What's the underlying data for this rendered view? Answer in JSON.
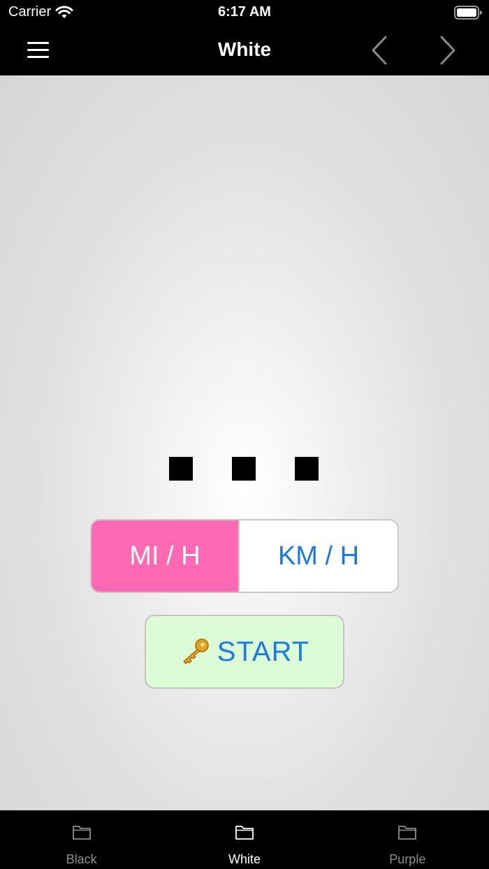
{
  "status_bar": {
    "carrier": "Carrier",
    "time": "6:17 AM"
  },
  "nav": {
    "title": "White",
    "menu_icon": "hamburger-menu-icon",
    "prev_icon": "chevron-left-icon",
    "next_icon": "chevron-right-icon"
  },
  "units": {
    "options": [
      {
        "label": "MI / H",
        "selected": true
      },
      {
        "label": "KM / H",
        "selected": false
      }
    ],
    "selected_color": "#ff69b4",
    "unselected_text_color": "#1a7ae2"
  },
  "start": {
    "icon": "🔑",
    "label": "START",
    "background": "#dcfcd6"
  },
  "tabs": [
    {
      "label": "Black",
      "icon": "folder-icon",
      "active": false
    },
    {
      "label": "White",
      "icon": "folder-icon",
      "active": true
    },
    {
      "label": "Purple",
      "icon": "folder-icon",
      "active": false
    }
  ]
}
